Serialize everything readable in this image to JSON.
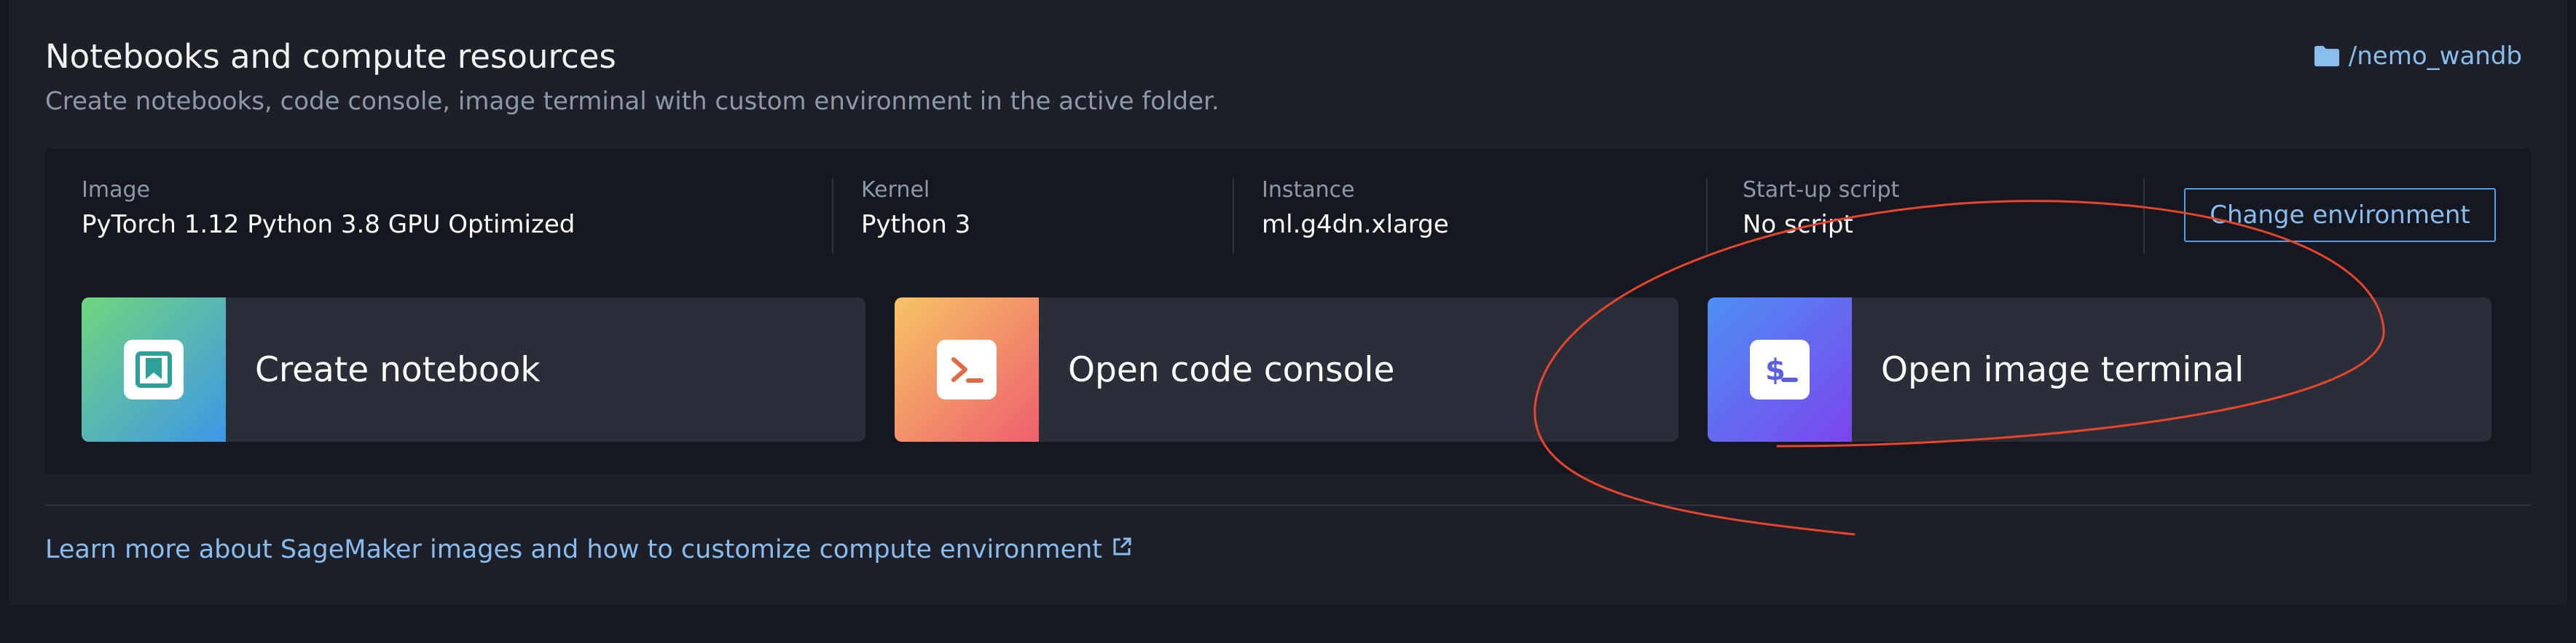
{
  "header": {
    "title": "Notebooks and compute resources",
    "subtitle": "Create notebooks, code console, image terminal with custom environment in the active folder.",
    "folder_icon": "folder-icon",
    "folder_path": "/nemo_wandb"
  },
  "environment": {
    "image_label": "Image",
    "image_value": "PyTorch 1.12 Python 3.8 GPU Optimized",
    "kernel_label": "Kernel",
    "kernel_value": "Python 3",
    "instance_label": "Instance",
    "instance_value": "ml.g4dn.xlarge",
    "startup_label": "Start-up script",
    "startup_value": "No script",
    "change_button": "Change environment"
  },
  "cards": [
    {
      "label": "Create notebook",
      "icon": "notebook-icon",
      "gradient": [
        "#6fd67e",
        "#3f96e8"
      ]
    },
    {
      "label": "Open code console",
      "icon": "console-icon",
      "gradient": [
        "#f6c365",
        "#ee5f6e"
      ]
    },
    {
      "label": "Open image terminal",
      "icon": "terminal-icon",
      "gradient": [
        "#4d8ff3",
        "#7c45ee"
      ]
    }
  ],
  "footer": {
    "learn_more": "Learn more about SageMaker images and how to customize compute environment",
    "external_icon": "external-link-icon"
  },
  "colors": {
    "accent": "#89bdee",
    "button_border": "#539fe5",
    "annotation": "#e8452c"
  }
}
